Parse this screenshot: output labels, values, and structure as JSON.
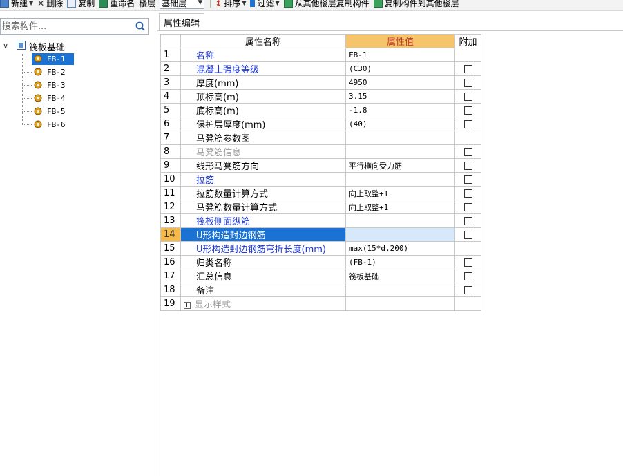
{
  "toolbar": {
    "new_label": "新建",
    "delete_label": "删除",
    "copy_label": "复制",
    "rename_label": "重命名",
    "floor_label": "楼层",
    "floor_value": "基础层",
    "sort_label": "排序",
    "filter_label": "过滤",
    "copy_from_label": "从其他楼层复制构件",
    "copy_to_label": "复制构件到其他楼层"
  },
  "left_panel": {
    "search_placeholder": "搜索构件...",
    "tree": {
      "root_label": "筏板基础",
      "items": [
        "FB-1",
        "FB-2",
        "FB-3",
        "FB-4",
        "FB-5",
        "FB-6"
      ],
      "selected_index": 0
    }
  },
  "right_panel": {
    "tab_label": "属性编辑",
    "table": {
      "headers": [
        "",
        "属性名称",
        "属性值",
        "附加"
      ],
      "rows": [
        {
          "num": "1",
          "name": "名称",
          "value": "FB-1",
          "checkbox": false,
          "style": "blue"
        },
        {
          "num": "2",
          "name": "混凝土强度等级",
          "value": "(C30)",
          "checkbox": true,
          "style": "blue"
        },
        {
          "num": "3",
          "name": "厚度(mm)",
          "value": "4950",
          "checkbox": true,
          "style": "normal"
        },
        {
          "num": "4",
          "name": "顶标高(m)",
          "value": "3.15",
          "checkbox": true,
          "style": "normal"
        },
        {
          "num": "5",
          "name": "底标高(m)",
          "value": "-1.8",
          "checkbox": true,
          "style": "normal"
        },
        {
          "num": "6",
          "name": "保护层厚度(mm)",
          "value": "(40)",
          "checkbox": true,
          "style": "normal"
        },
        {
          "num": "7",
          "name": "马凳筋参数图",
          "value": "",
          "checkbox": false,
          "style": "normal"
        },
        {
          "num": "8",
          "name": "马凳筋信息",
          "value": "",
          "checkbox": true,
          "style": "gray"
        },
        {
          "num": "9",
          "name": "线形马凳筋方向",
          "value": "平行横向受力筋",
          "checkbox": true,
          "style": "normal"
        },
        {
          "num": "10",
          "name": "拉筋",
          "value": "",
          "checkbox": true,
          "style": "blue"
        },
        {
          "num": "11",
          "name": "拉筋数量计算方式",
          "value": "向上取整+1",
          "checkbox": true,
          "style": "normal"
        },
        {
          "num": "12",
          "name": "马凳筋数量计算方式",
          "value": "向上取整+1",
          "checkbox": true,
          "style": "normal"
        },
        {
          "num": "13",
          "name": "筏板侧面纵筋",
          "value": "",
          "checkbox": true,
          "style": "blue"
        },
        {
          "num": "14",
          "name": "U形构造封边钢筋",
          "value": "",
          "checkbox": true,
          "style": "selected"
        },
        {
          "num": "15",
          "name": "U形构造封边钢筋弯折长度(mm)",
          "value": "max(15*d,200)",
          "checkbox": false,
          "style": "blue"
        },
        {
          "num": "16",
          "name": "归类名称",
          "value": "(FB-1)",
          "checkbox": true,
          "style": "normal"
        },
        {
          "num": "17",
          "name": "汇总信息",
          "value": "筏板基础",
          "checkbox": true,
          "style": "normal"
        },
        {
          "num": "18",
          "name": "备注",
          "value": "",
          "checkbox": true,
          "style": "normal"
        },
        {
          "num": "19",
          "name": "显示样式",
          "value": "",
          "checkbox": false,
          "style": "group"
        }
      ]
    }
  },
  "colors": {
    "accent_blue": "#1a72d4",
    "link_blue": "#1a35d6",
    "header_orange": "#f6c46a",
    "header_red_text": "#c0392b",
    "gray_text": "#9a9a9a"
  },
  "icons": {
    "search": "search-icon",
    "tree_root": "component-group-icon",
    "tree_item": "gear-icon"
  }
}
